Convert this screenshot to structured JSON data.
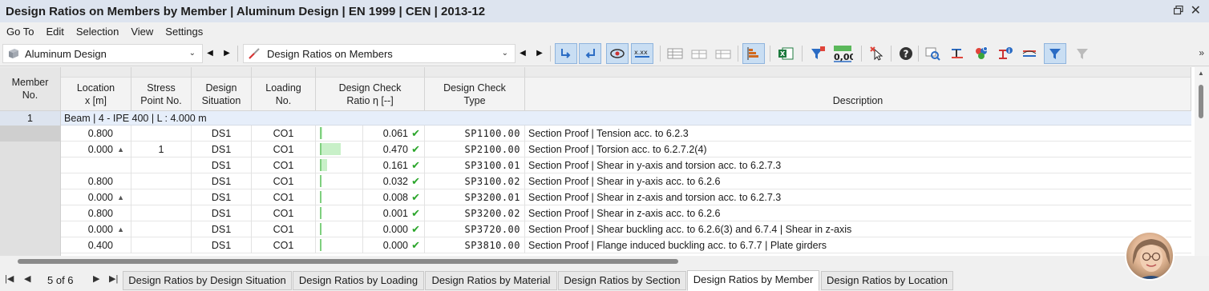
{
  "window": {
    "title": "Design Ratios on Members by Member | Aluminum Design | EN 1999 | CEN | 2013-12"
  },
  "menu": [
    "Go To",
    "Edit",
    "Selection",
    "View",
    "Settings"
  ],
  "toolbar": {
    "module_combo": "Aluminum Design",
    "table_combo": "Design Ratios on Members"
  },
  "table": {
    "headers": {
      "member": "Member\nNo.",
      "location": "Location\nx [m]",
      "stress_point": "Stress\nPoint No.",
      "design_situation": "Design\nSituation",
      "loading": "Loading\nNo.",
      "ratio": "Design Check\nRatio η [--]",
      "type": "Design Check\nType",
      "description": "Description"
    },
    "group": {
      "member_no": "1",
      "label": "Beam | 4 - IPE 400 | L : 4.000 m"
    },
    "rows": [
      {
        "location": "0.800",
        "marker": false,
        "stress_point": "",
        "ds": "DS1",
        "loading": "CO1",
        "ratio": "0.061",
        "ratio_value": 0.061,
        "type": "SP1100.00",
        "description": "Section Proof | Tension acc. to 6.2.3"
      },
      {
        "location": "0.000",
        "marker": true,
        "stress_point": "1",
        "ds": "DS1",
        "loading": "CO1",
        "ratio": "0.470",
        "ratio_value": 0.47,
        "type": "SP2100.00",
        "description": "Section Proof | Torsion acc. to 6.2.7.2(4)"
      },
      {
        "location": "",
        "marker": false,
        "stress_point": "",
        "ds": "DS1",
        "loading": "CO1",
        "ratio": "0.161",
        "ratio_value": 0.161,
        "type": "SP3100.01",
        "description": "Section Proof | Shear in y-axis and torsion acc. to 6.2.7.3"
      },
      {
        "location": "0.800",
        "marker": false,
        "stress_point": "",
        "ds": "DS1",
        "loading": "CO1",
        "ratio": "0.032",
        "ratio_value": 0.032,
        "type": "SP3100.02",
        "description": "Section Proof | Shear in y-axis acc. to 6.2.6"
      },
      {
        "location": "0.000",
        "marker": true,
        "stress_point": "",
        "ds": "DS1",
        "loading": "CO1",
        "ratio": "0.008",
        "ratio_value": 0.008,
        "type": "SP3200.01",
        "description": "Section Proof | Shear in z-axis and torsion acc. to 6.2.7.3"
      },
      {
        "location": "0.800",
        "marker": false,
        "stress_point": "",
        "ds": "DS1",
        "loading": "CO1",
        "ratio": "0.001",
        "ratio_value": 0.001,
        "type": "SP3200.02",
        "description": "Section Proof | Shear in z-axis acc. to 6.2.6"
      },
      {
        "location": "0.000",
        "marker": true,
        "stress_point": "",
        "ds": "DS1",
        "loading": "CO1",
        "ratio": "0.000",
        "ratio_value": 0.0,
        "type": "SP3720.00",
        "description": "Section Proof | Shear buckling acc. to 6.2.6(3) and 6.7.4 | Shear in z-axis"
      },
      {
        "location": "0.400",
        "marker": false,
        "stress_point": "",
        "ds": "DS1",
        "loading": "CO1",
        "ratio": "0.000",
        "ratio_value": 0.0,
        "type": "SP3810.00",
        "description": "Section Proof | Flange induced buckling acc. to 6.7.7 | Plate girders"
      }
    ]
  },
  "pagination": {
    "page_info": "5 of 6"
  },
  "tabs": [
    {
      "label": "Design Ratios by Design Situation",
      "active": false
    },
    {
      "label": "Design Ratios by Loading",
      "active": false
    },
    {
      "label": "Design Ratios by Material",
      "active": false
    },
    {
      "label": "Design Ratios by Section",
      "active": false
    },
    {
      "label": "Design Ratios by Member",
      "active": true
    },
    {
      "label": "Design Ratios by Location",
      "active": false
    }
  ],
  "colors": {
    "ok_check": "#2aa52a",
    "ratio_bar": "#c8f0c8",
    "group_row": "#e6eefa"
  }
}
